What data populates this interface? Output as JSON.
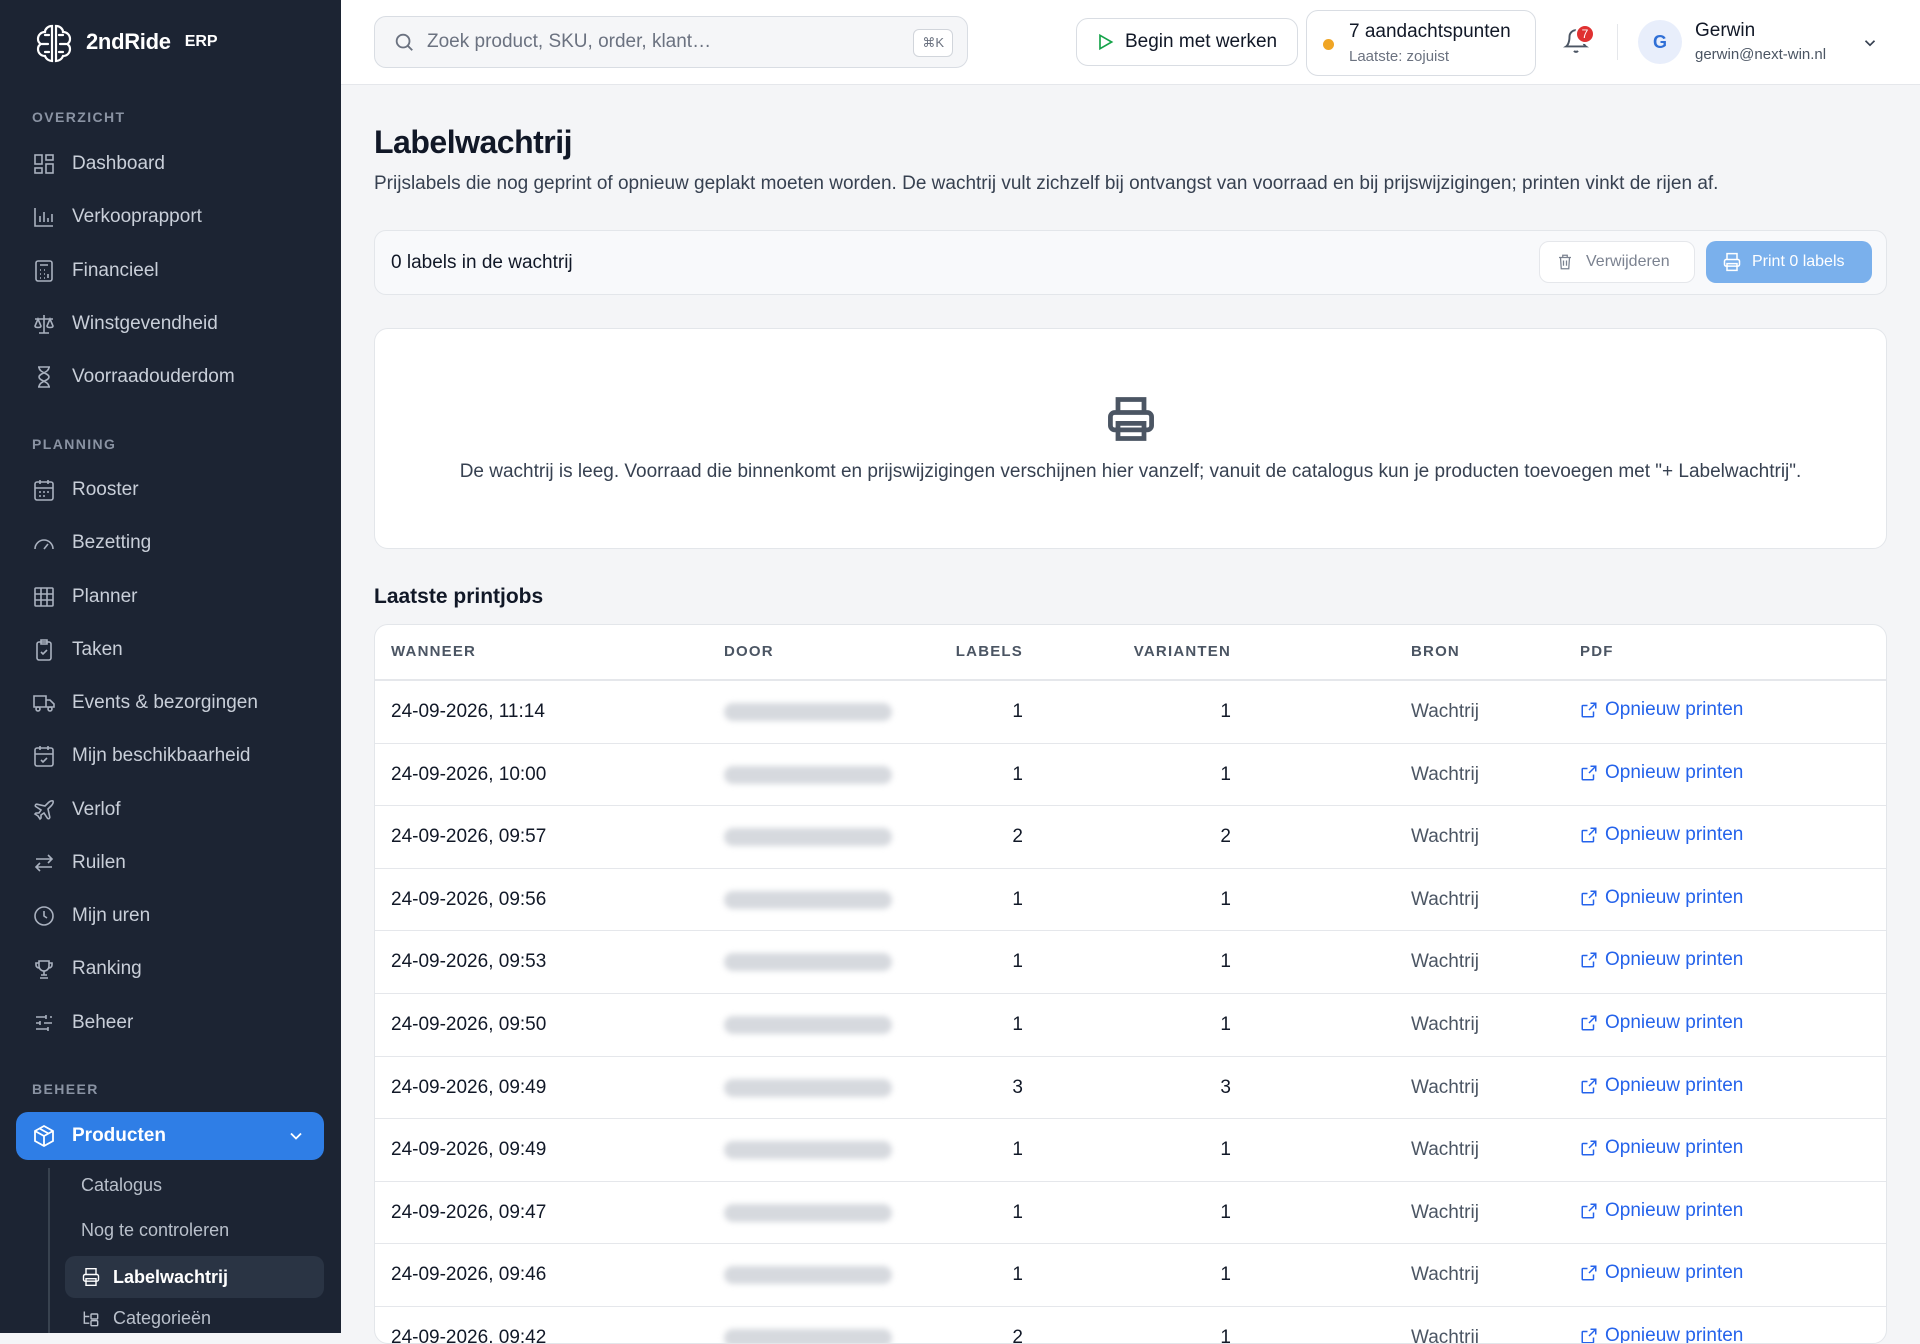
{
  "brand": {
    "name": "2ndRide",
    "suffix": "ERP"
  },
  "sidebar": {
    "sections": [
      {
        "title": "OVERZICHT"
      },
      {
        "title": "PLANNING"
      },
      {
        "title": "BEHEER"
      }
    ],
    "items": [
      {
        "label": "Dashboard",
        "icon": "dashboard-icon"
      },
      {
        "label": "Verkooprapport",
        "icon": "bar-chart-icon"
      },
      {
        "label": "Financieel",
        "icon": "calculator-icon"
      },
      {
        "label": "Winstgevendheid",
        "icon": "scale-icon"
      },
      {
        "label": "Voorraadouderdom",
        "icon": "hourglass-icon"
      },
      {
        "label": "Rooster",
        "icon": "calendar-icon"
      },
      {
        "label": "Bezetting",
        "icon": "gauge-icon"
      },
      {
        "label": "Planner",
        "icon": "grid-icon"
      },
      {
        "label": "Taken",
        "icon": "clipboard-icon"
      },
      {
        "label": "Events & bezorgingen",
        "icon": "truck-icon"
      },
      {
        "label": "Mijn beschikbaarheid",
        "icon": "calendar-check-icon"
      },
      {
        "label": "Verlof",
        "icon": "plane-icon"
      },
      {
        "label": "Ruilen",
        "icon": "swap-icon"
      },
      {
        "label": "Mijn uren",
        "icon": "clock-icon"
      },
      {
        "label": "Ranking",
        "icon": "trophy-icon"
      },
      {
        "label": "Beheer",
        "icon": "sliders-icon"
      }
    ],
    "active": {
      "label": "Producten",
      "icon": "box-icon"
    },
    "subitems": [
      {
        "label": "Catalogus"
      },
      {
        "label": "Nog te controleren"
      },
      {
        "label": "Labelwachtrij",
        "icon": "printer-icon"
      },
      {
        "label": "Categorieën",
        "icon": "tree-icon"
      }
    ]
  },
  "topbar": {
    "search_placeholder": "Zoek product, SKU, order, klant…",
    "search_shortcut": "⌘K",
    "start_button": "Begin met werken",
    "attention_title": "7 aandachtspunten",
    "attention_sub": "Laatste: zojuist",
    "notification_count": "7",
    "user_initial": "G",
    "user_name": "Gerwin",
    "user_email": "gerwin@next-win.nl"
  },
  "page": {
    "title": "Labelwachtrij",
    "subtitle": "Prijslabels die nog geprint of opnieuw geplakt moeten worden. De wachtrij vult zichzelf bij ontvangst van voorraad en bij prijswijzigingen; printen vinkt de rijen af.",
    "queue_count": "0 labels in de wachtrij",
    "delete_button": "Verwijderen",
    "print_button": "Print 0 labels",
    "empty_text": "De wachtrij is leeg. Voorraad die binnenkomt en prijswijzigingen verschijnen hier vanzelf; vanuit de catalogus kun je producten toevoegen met \"+ Labelwachtrij\".",
    "jobs_title": "Laatste printjobs"
  },
  "table": {
    "headers": {
      "when": "WANNEER",
      "by": "DOOR",
      "labels": "LABELS",
      "variants": "VARIANTEN",
      "source": "BRON",
      "pdf": "PDF"
    },
    "rows": [
      {
        "when": "24-09-2026, 11:14",
        "labels": "1",
        "variants": "1",
        "source": "Wachtrij",
        "action": "Opnieuw printen"
      },
      {
        "when": "24-09-2026, 10:00",
        "labels": "1",
        "variants": "1",
        "source": "Wachtrij",
        "action": "Opnieuw printen"
      },
      {
        "when": "24-09-2026, 09:57",
        "labels": "2",
        "variants": "2",
        "source": "Wachtrij",
        "action": "Opnieuw printen"
      },
      {
        "when": "24-09-2026, 09:56",
        "labels": "1",
        "variants": "1",
        "source": "Wachtrij",
        "action": "Opnieuw printen"
      },
      {
        "when": "24-09-2026, 09:53",
        "labels": "1",
        "variants": "1",
        "source": "Wachtrij",
        "action": "Opnieuw printen"
      },
      {
        "when": "24-09-2026, 09:50",
        "labels": "1",
        "variants": "1",
        "source": "Wachtrij",
        "action": "Opnieuw printen"
      },
      {
        "when": "24-09-2026, 09:49",
        "labels": "3",
        "variants": "3",
        "source": "Wachtrij",
        "action": "Opnieuw printen"
      },
      {
        "when": "24-09-2026, 09:49",
        "labels": "1",
        "variants": "1",
        "source": "Wachtrij",
        "action": "Opnieuw printen"
      },
      {
        "when": "24-09-2026, 09:47",
        "labels": "1",
        "variants": "1",
        "source": "Wachtrij",
        "action": "Opnieuw printen"
      },
      {
        "when": "24-09-2026, 09:46",
        "labels": "1",
        "variants": "1",
        "source": "Wachtrij",
        "action": "Opnieuw printen"
      },
      {
        "when": "24-09-2026, 09:42",
        "labels": "2",
        "variants": "1",
        "source": "Wachtrij",
        "action": "Opnieuw printen"
      }
    ]
  },
  "colors": {
    "sidebar": "#1c2433",
    "accent": "#2f7ee6",
    "link": "#2563eb",
    "badge": "#e03131",
    "status_dot": "#f0a524"
  }
}
